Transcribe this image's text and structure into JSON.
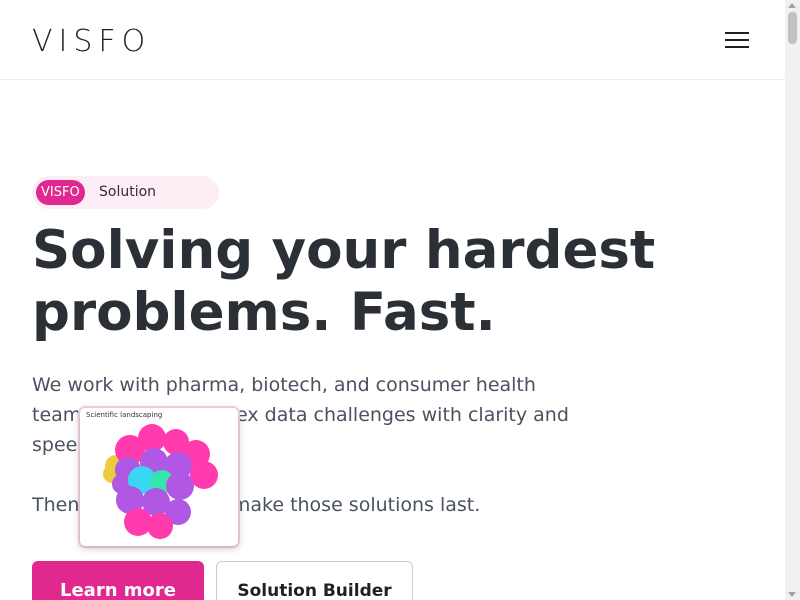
{
  "header": {
    "logo": "VISFO",
    "menu_icon": "hamburger-menu-icon"
  },
  "hero": {
    "pill_tag": "VISFO",
    "pill_text": "Solution",
    "title_line1": "Solving your hardest",
    "title_line2": "problems. Fast.",
    "description": "We work with pharma, biotech, and consumer health teams to solve complex data challenges with clarity and speed.",
    "description2": "Then we help you to make those solutions last."
  },
  "popup": {
    "title": "Scientific landscaping"
  },
  "buttons": {
    "primary": "Learn more",
    "secondary": "Solution Builder"
  },
  "colors": {
    "accent": "#e0288f",
    "pill_bg": "#fdeef6",
    "text": "#2b2f36"
  }
}
